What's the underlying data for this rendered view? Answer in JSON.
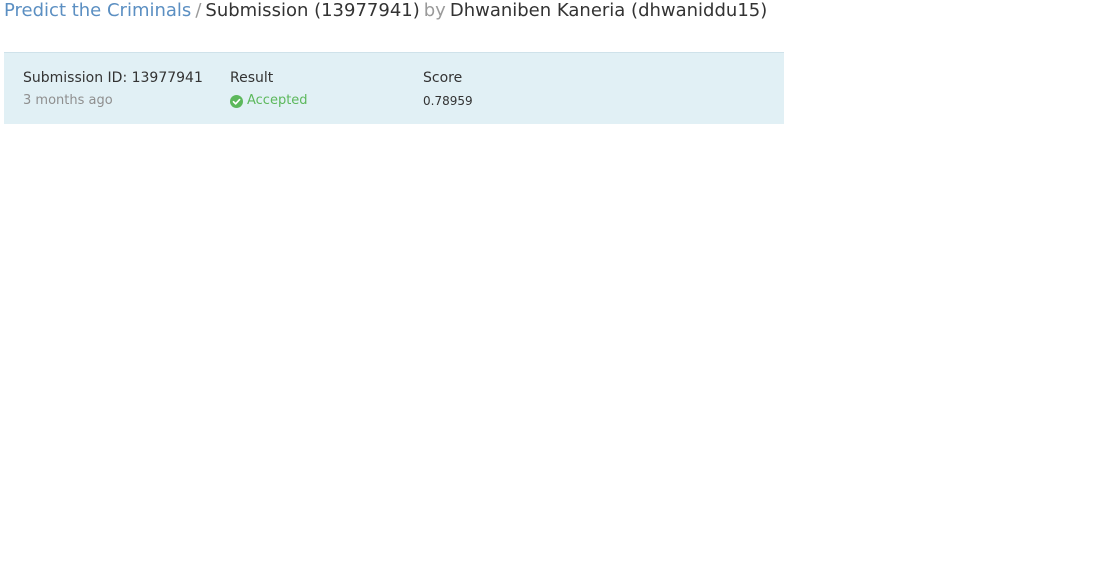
{
  "breadcrumb": {
    "problem_link": "Predict the Criminals",
    "separator": "/",
    "current": "Submission (13977941)",
    "by": "by",
    "author": "Dhwaniben Kaneria (dhwaniddu15)"
  },
  "submission": {
    "id_label": "Submission ID: 13977941",
    "time_ago": "3 months ago",
    "result_header": "Result",
    "result_value": "Accepted",
    "result_icon": "check-circle-icon",
    "score_header": "Score",
    "score_value": "0.78959"
  },
  "colors": {
    "link": "#5b8fc2",
    "panel_bg": "#e1f0f5",
    "accepted": "#5cb85c"
  }
}
